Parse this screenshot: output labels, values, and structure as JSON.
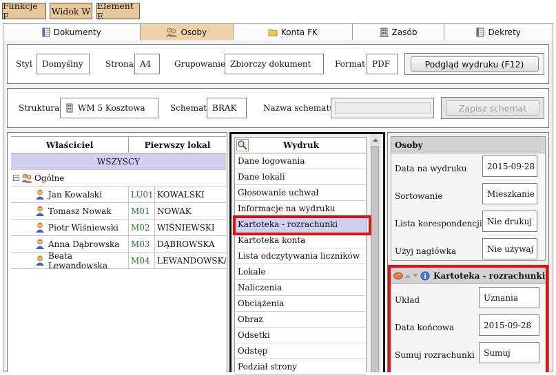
{
  "top_menu": [
    {
      "label": "Funkcje F"
    },
    {
      "label": "Widok W"
    },
    {
      "label": "Element E"
    }
  ],
  "tabs": [
    {
      "label": "Dokumenty",
      "icon": "document-icon"
    },
    {
      "label": "Osoby",
      "icon": "people-icon",
      "active": true
    },
    {
      "label": "Konta FK",
      "icon": "folder-icon"
    },
    {
      "label": "Zasób",
      "icon": "building-icon"
    },
    {
      "label": "Dekrety",
      "icon": "document-icon"
    }
  ],
  "print_settings": {
    "styl_label": "Styl",
    "styl_value": "Domyślny",
    "strona_label": "Strona",
    "strona_value": "A4",
    "grupowanie_label": "Grupowanie",
    "grupowanie_value": "Zbiorczy dokument",
    "format_label": "Format",
    "format_value": "PDF",
    "preview_button": "Podgląd wydruku (F12)"
  },
  "schema_settings": {
    "struktura_label": "Struktura",
    "struktura_value": "WM 5 Kosztowa",
    "schemat_label": "Schemat",
    "schemat_value": "BRAK",
    "nazwa_label": "Nazwa schematu",
    "nazwa_value": "",
    "save_button": "Zapisz schemat"
  },
  "owners_table": {
    "headers": [
      "Właściciel",
      "Pierwszy lokal"
    ],
    "all_row": "WSZYSCY",
    "group_label": "Ogólne",
    "rows": [
      {
        "name": "Jan Kowalski",
        "code": "LU01",
        "lokal": "KOWALSKI"
      },
      {
        "name": "Tomasz Nowak",
        "code": "M01",
        "lokal": "NOWAK"
      },
      {
        "name": "Piotr Wiśniewski",
        "code": "M02",
        "lokal": "WIŚNIEWSKI"
      },
      {
        "name": "Anna Dąbrowska",
        "code": "M03",
        "lokal": "DĄBROWSKA"
      },
      {
        "name": "Beata Lewandowska",
        "code": "M04",
        "lokal": "LEWANDOWSKA"
      }
    ]
  },
  "print_list": {
    "header": "Wydruk",
    "items": [
      "Dane logowania",
      "Dane lokali",
      "Głosowanie uchwał",
      "Informacje na wydruku",
      "Kartoteka - rozrachunki",
      "Kartoteka konta",
      "Lista odczytywania liczników",
      "Lokale",
      "Naliczenia",
      "Obciążenia",
      "Obraz",
      "Odsetki",
      "Odstęp",
      "Podział strony"
    ],
    "selected_index": 4
  },
  "osoby_panel": {
    "title": "Osoby",
    "fields": [
      {
        "label": "Data na wydruku",
        "value": "2015-09-28"
      },
      {
        "label": "Sortowanie",
        "value": "Mieszkanie"
      },
      {
        "label": "Lista korespondencji",
        "value": "Nie drukuj"
      },
      {
        "label": "Użyj nagłówka",
        "value": "Nie używaj"
      }
    ]
  },
  "kartoteka_panel": {
    "title": "Kartoteka - rozrachunki",
    "fields": [
      {
        "label": "Układ",
        "value": "Uznania"
      },
      {
        "label": "Data końcowa",
        "value": "2015-09-28"
      },
      {
        "label": "Sumuj rozrachunki",
        "value": "Sumuj"
      }
    ]
  },
  "colors": {
    "menu_button": "#e6c79c",
    "active_tab": "#f0d2a8",
    "selected_row": "#d0d0f2",
    "highlight": "#e01010",
    "code_text": "#1f7a1f"
  }
}
